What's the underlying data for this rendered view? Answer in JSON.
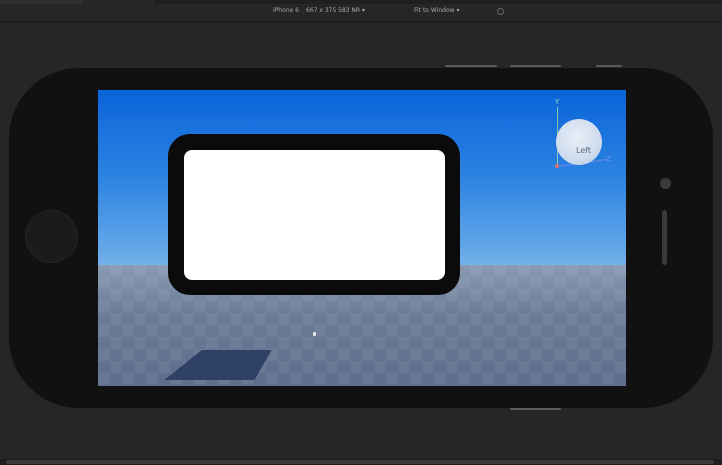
{
  "toolbar": {
    "device": "iPhone 6",
    "resolution": "667 x 375",
    "dpi_label": "583 NR",
    "fit_label": "Fit to Window",
    "dropdown_glyph": "▾"
  },
  "viewport": {
    "view_cube_label": "Left",
    "axis_y": "Y",
    "axis_z": "Z"
  },
  "colors": {
    "sky_top": "#0a64da",
    "sky_horizon": "#c6daee",
    "floor": "#6a7a96",
    "phone_body": "#111111",
    "ui_frame": "#0b0b0b",
    "ui_inner": "#ffffff"
  },
  "icons": {
    "rotate": "rotate-icon",
    "device_dropdown": "chevron-down-icon"
  }
}
